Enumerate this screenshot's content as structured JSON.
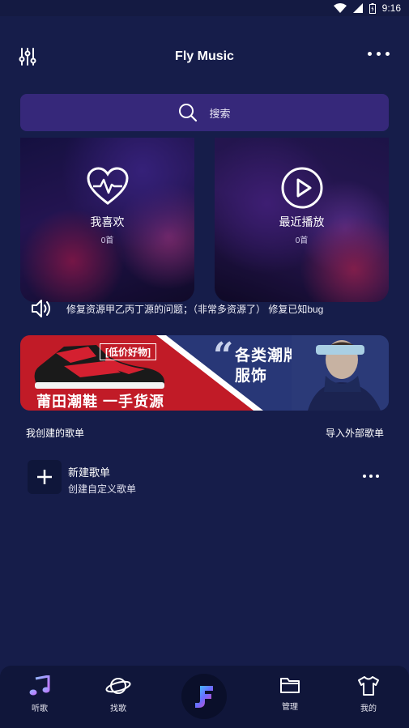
{
  "status": {
    "time": "9:16"
  },
  "header": {
    "title": "Fly Music",
    "eq_icon": "equalizer-icon",
    "more_icon": "more-icon"
  },
  "search": {
    "placeholder": "搜索"
  },
  "cards": [
    {
      "label": "我喜欢",
      "count": "0首",
      "icon": "heart-pulse-icon"
    },
    {
      "label": "最近播放",
      "count": "0首",
      "icon": "play-circle-icon"
    }
  ],
  "notice": {
    "text": "修复资源甲乙丙丁源的问题；（非常多资源了） 修复已知bug",
    "icon": "speaker-icon"
  },
  "banner": {
    "tag": "[低价好物]",
    "left_text": "莆田潮鞋 一手货源",
    "right_line1": "各类潮牌",
    "right_line2": "服饰"
  },
  "playlists": {
    "section_title": "我创建的歌单",
    "import_label": "导入外部歌单",
    "new_item": {
      "name": "新建歌单",
      "desc": "创建自定义歌单"
    }
  },
  "tabs": [
    {
      "label": "听歌",
      "icon": "music-note-icon"
    },
    {
      "label": "找歌",
      "icon": "planet-icon"
    },
    {
      "label": "管理",
      "icon": "folder-icon"
    },
    {
      "label": "我的",
      "icon": "tshirt-icon"
    }
  ],
  "colors": {
    "background": "#161d4a",
    "search_bg": "#36287a",
    "tabbar_bg": "#10163a",
    "banner_red": "#c11b27"
  }
}
